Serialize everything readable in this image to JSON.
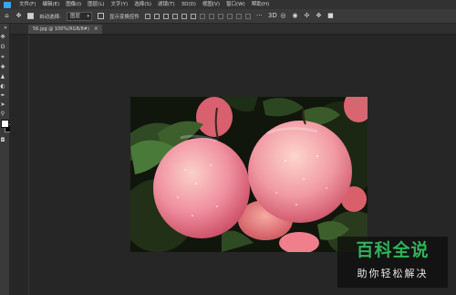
{
  "menubar": {
    "items": [
      "文件(F)",
      "编辑(E)",
      "图像(I)",
      "图层(L)",
      "文字(Y)",
      "选择(S)",
      "滤镜(T)",
      "3D(D)",
      "视图(V)",
      "窗口(W)",
      "帮助(H)"
    ]
  },
  "options": {
    "auto_select_label": "自动选择:",
    "auto_select_value": "图层",
    "show_transform_label": "显示变换控件"
  },
  "document": {
    "tab_title": "56.jpg @ 100%(RGB/8#)",
    "close_glyph": "×"
  },
  "watermark": {
    "title": "百科全说",
    "subtitle": "助你轻松解决"
  },
  "colors": {
    "foreground": "#ffffff",
    "background": "#000000",
    "watermark_accent": "#2fb45a"
  }
}
